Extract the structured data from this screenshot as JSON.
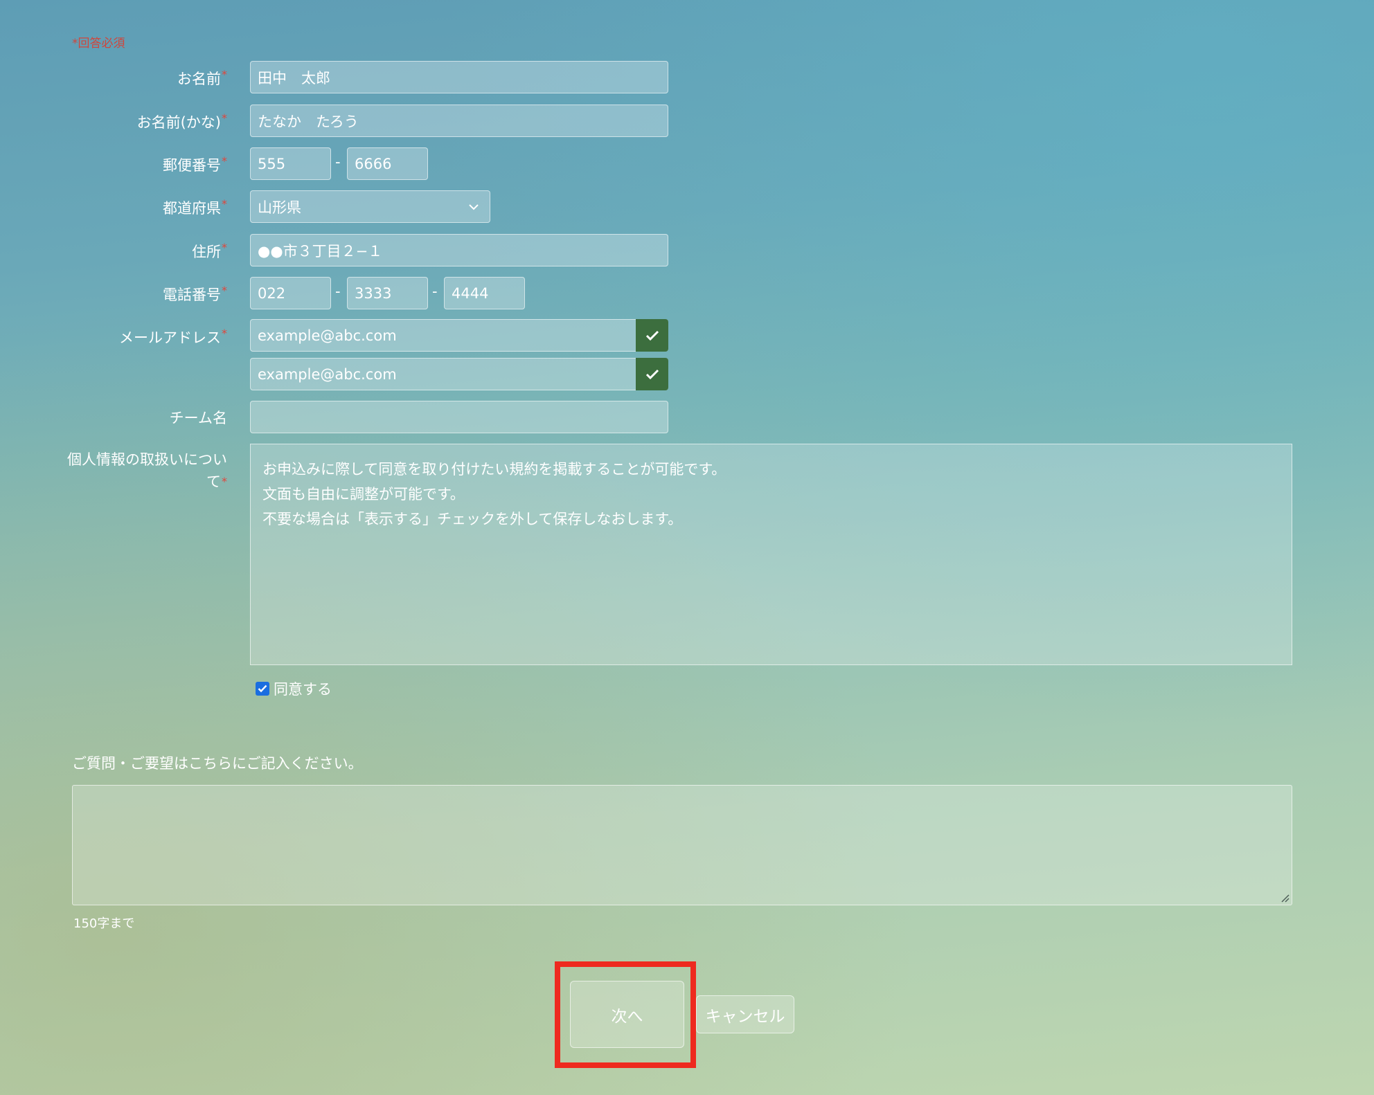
{
  "required_note": "*回答必須",
  "required_star": "*",
  "name": {
    "label": "お名前",
    "value": "田中　太郎"
  },
  "kana": {
    "label": "お名前(かな)",
    "value": "たなか　たろう"
  },
  "postal": {
    "label": "郵便番号",
    "part1": "555",
    "part2": "6666",
    "separator": "-"
  },
  "prefecture": {
    "label": "都道府県",
    "selected": "山形県"
  },
  "address": {
    "label": "住所",
    "value": "●●市３丁目２−１"
  },
  "phone": {
    "label": "電話番号",
    "part1": "022",
    "part2": "3333",
    "part3": "4444",
    "separator": "-"
  },
  "email": {
    "label": "メールアドレス",
    "value": "example@abc.com",
    "confirm_value": "example@abc.com"
  },
  "team": {
    "label": "チーム名",
    "value": ""
  },
  "policy": {
    "label": "個人情報の取扱いについて",
    "lines": [
      "お申込みに際して同意を取り付けたい規約を掲載することが可能です。",
      "文面も自由に調整が可能です。",
      "不要な場合は「表示する」チェックを外して保存しなおします。"
    ],
    "agree_label": "同意する",
    "agree_checked": true
  },
  "question": {
    "label": "ご質問・ご要望はこちらにご記入ください。",
    "value": "",
    "limit_note": "150字まで"
  },
  "buttons": {
    "next": "次へ",
    "cancel": "キャンセル"
  },
  "colors": {
    "required": "#e0463c",
    "check_bg": "#3c6e3e",
    "highlight": "#ee2a1f",
    "checkbox": "#1a6ee0"
  },
  "icons": {
    "email_valid": "check-icon",
    "select": "chevron-down-icon",
    "textarea_resize": "resize-grip-icon"
  }
}
